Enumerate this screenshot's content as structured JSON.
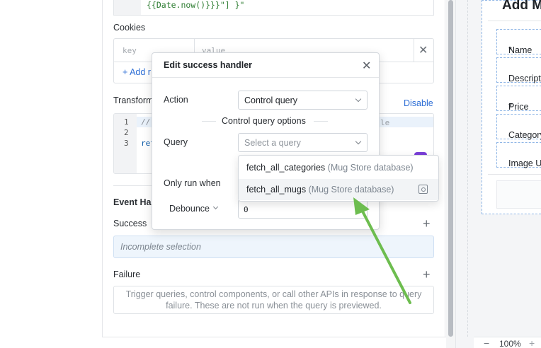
{
  "query_editor": {
    "code_top_line": "{{Date.now()}}}\"] }\"",
    "cookies_label": "Cookies",
    "cookies_key_placeholder": "key",
    "cookies_value_placeholder": "value",
    "cookies_add_label": "+ Add r",
    "transformer_label": "Transform",
    "disable_label": "Disable",
    "code_lines": [
      "1",
      "2",
      "3"
    ],
    "code_line1": "//",
    "code_line3": "ret",
    "code_tail": "le",
    "event_handlers_label": "Event Har",
    "success_label": "Success",
    "success_value": "Incomplete selection",
    "failure_label": "Failure",
    "failure_text_1": "Trigger queries, control components, or call other APIs in response to query",
    "failure_text_2": "failure. These are not run when the query is previewed."
  },
  "modal": {
    "title": "Edit success handler",
    "action_label": "Action",
    "action_value": "Control query",
    "options_title": "Control query options",
    "query_label": "Query",
    "query_placeholder": "Select a query",
    "only_run_label": "Only run when",
    "debounce_label": "Debounce",
    "debounce_value": "0"
  },
  "dropdown": {
    "items": [
      {
        "name": "fetch_all_categories",
        "source": "(Mug Store database)"
      },
      {
        "name": "fetch_all_mugs",
        "source": "(Mug Store database)"
      }
    ]
  },
  "canvas": {
    "form_title": "Add M",
    "fields": [
      {
        "label": "Name",
        "required": "*"
      },
      {
        "label": "Descriptio",
        "required": ""
      },
      {
        "label": "Price",
        "required": "*"
      },
      {
        "label": "Category",
        "required": ""
      },
      {
        "label": "Image UR",
        "required": ""
      }
    ],
    "zoom_minus": "−",
    "zoom_value": "100%",
    "zoom_plus": "+"
  },
  "icons": {
    "close": "close-icon",
    "add": "plus-icon",
    "chevron": "chevron-down-icon",
    "annotation_arrow_color": "#6dbd4f"
  }
}
